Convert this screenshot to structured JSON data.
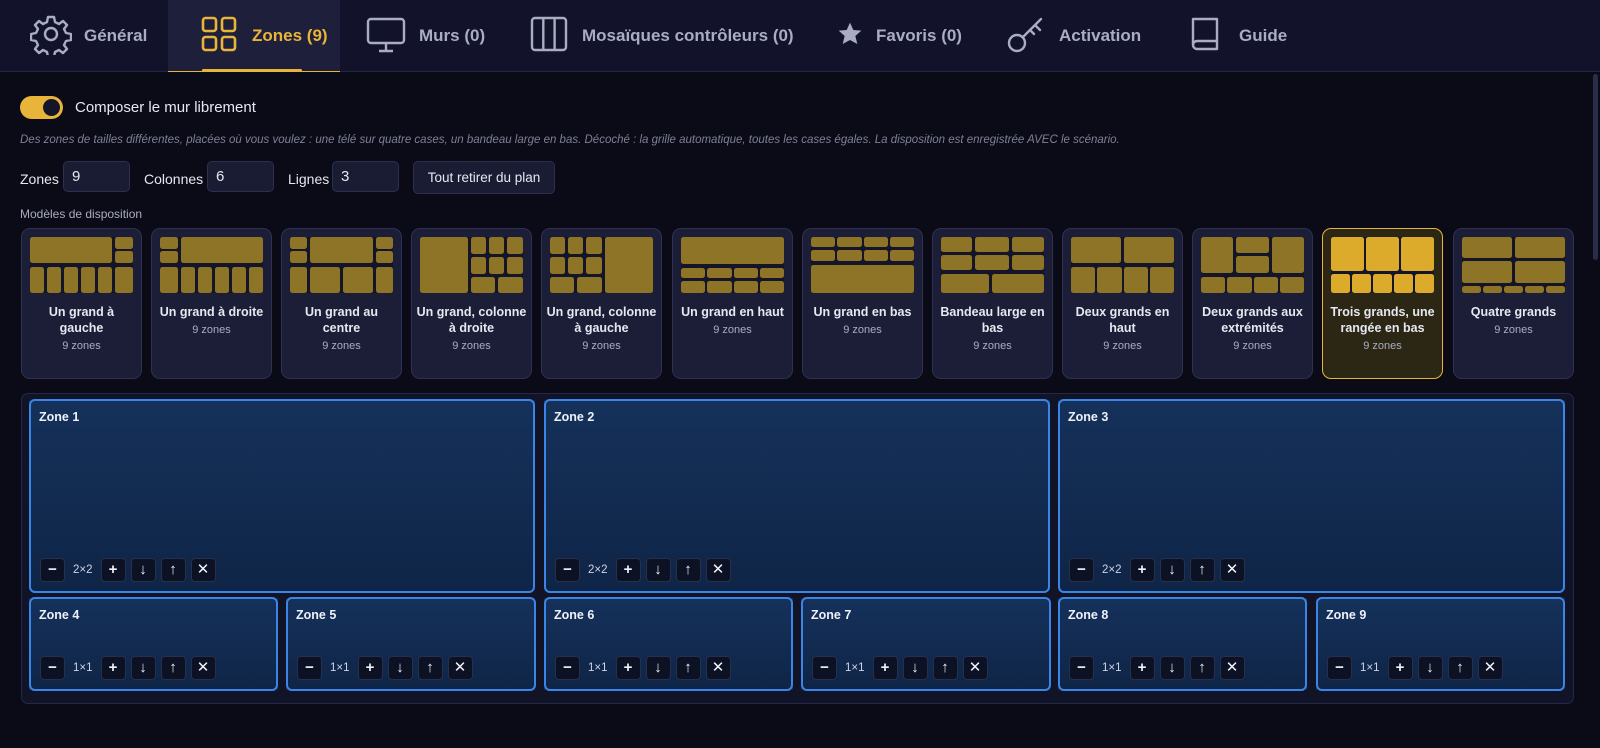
{
  "nav": {
    "tabs": [
      {
        "id": "general",
        "label": "Général",
        "icon": "gear-icon"
      },
      {
        "id": "zones",
        "label": "Zones (9)",
        "icon": "grid-icon",
        "active": true
      },
      {
        "id": "murs",
        "label": "Murs (0)",
        "icon": "monitor-icon"
      },
      {
        "id": "mosaiques",
        "label": "Mosaïques contrôleurs (0)",
        "icon": "columns-icon"
      },
      {
        "id": "favoris",
        "label": "Favoris (0)",
        "icon": "star-icon"
      },
      {
        "id": "activation",
        "label": "Activation",
        "icon": "key-icon"
      },
      {
        "id": "guide",
        "label": "Guide",
        "icon": "book-icon"
      }
    ]
  },
  "compose": {
    "toggle_on": true,
    "label": "Composer le mur librement",
    "help": "Des zones de tailles différentes, placées où vous voulez : une télé sur quatre cases, un bandeau large en bas. Décoché : la grille automatique, toutes les cases égales. La disposition est enregistrée AVEC le scénario."
  },
  "fields": {
    "zones_label": "Zones",
    "zones_value": "9",
    "cols_label": "Colonnes",
    "cols_value": "6",
    "rows_label": "Lignes",
    "rows_value": "3",
    "clear_button": "Tout retirer du plan"
  },
  "models": {
    "title": "Modèles de disposition",
    "cards": [
      {
        "name": "Un grand à gauche",
        "count": "9 zones"
      },
      {
        "name": "Un grand à droite",
        "count": "9 zones"
      },
      {
        "name": "Un grand au centre",
        "count": "9 zones"
      },
      {
        "name": "Un grand, colonne à droite",
        "count": "9 zones"
      },
      {
        "name": "Un grand, colonne à gauche",
        "count": "9 zones"
      },
      {
        "name": "Un grand en haut",
        "count": "9 zones"
      },
      {
        "name": "Un grand en bas",
        "count": "9 zones"
      },
      {
        "name": "Bandeau large en bas",
        "count": "9 zones"
      },
      {
        "name": "Deux grands en haut",
        "count": "9 zones"
      },
      {
        "name": "Deux grands aux extrémités",
        "count": "9 zones"
      },
      {
        "name": "Trois grands, une rangée en bas",
        "count": "9 zones",
        "active": true
      },
      {
        "name": "Quatre grands",
        "count": "9 zones"
      }
    ]
  },
  "zones": [
    {
      "name": "Zone 1",
      "size": "2×2"
    },
    {
      "name": "Zone 2",
      "size": "2×2"
    },
    {
      "name": "Zone 3",
      "size": "2×2"
    },
    {
      "name": "Zone 4",
      "size": "1×1"
    },
    {
      "name": "Zone 5",
      "size": "1×1"
    },
    {
      "name": "Zone 6",
      "size": "1×1"
    },
    {
      "name": "Zone 7",
      "size": "1×1"
    },
    {
      "name": "Zone 8",
      "size": "1×1"
    },
    {
      "name": "Zone 9",
      "size": "1×1"
    }
  ],
  "controls": {
    "minus": "−",
    "plus": "+",
    "down": "↓",
    "up": "↑",
    "remove": "✕"
  },
  "colors": {
    "accent": "#e9b43a",
    "zone_border": "#3a86e8",
    "background": "#0a0b16"
  }
}
